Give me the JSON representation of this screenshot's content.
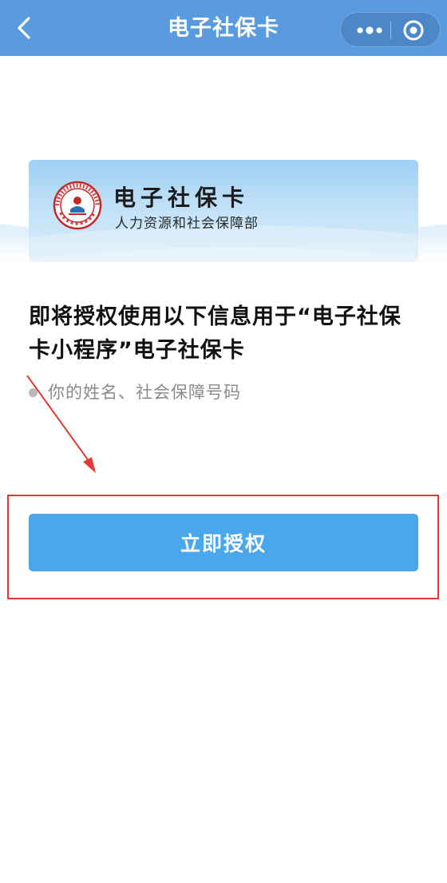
{
  "nav": {
    "title": "电子社保卡",
    "bar_color": "#5a9be0"
  },
  "icons": {
    "back": "chevron-left-icon",
    "more": "more-dots-icon",
    "close": "target-close-icon",
    "logo": "social-security-card-logo-icon"
  },
  "banner": {
    "title": "电子社保卡",
    "subtitle": "人力资源和社会保障部",
    "logo_text": "SOCIAL SECURITY CARD 社会保障卡"
  },
  "auth": {
    "heading": "即将授权使用以下信息用于“电子社保卡小程序”电子社保卡",
    "info_item": "你的姓名、社会保障号码",
    "button_label": "立即授权",
    "button_color": "#4aa7ec",
    "highlight_color": "#e53935"
  }
}
